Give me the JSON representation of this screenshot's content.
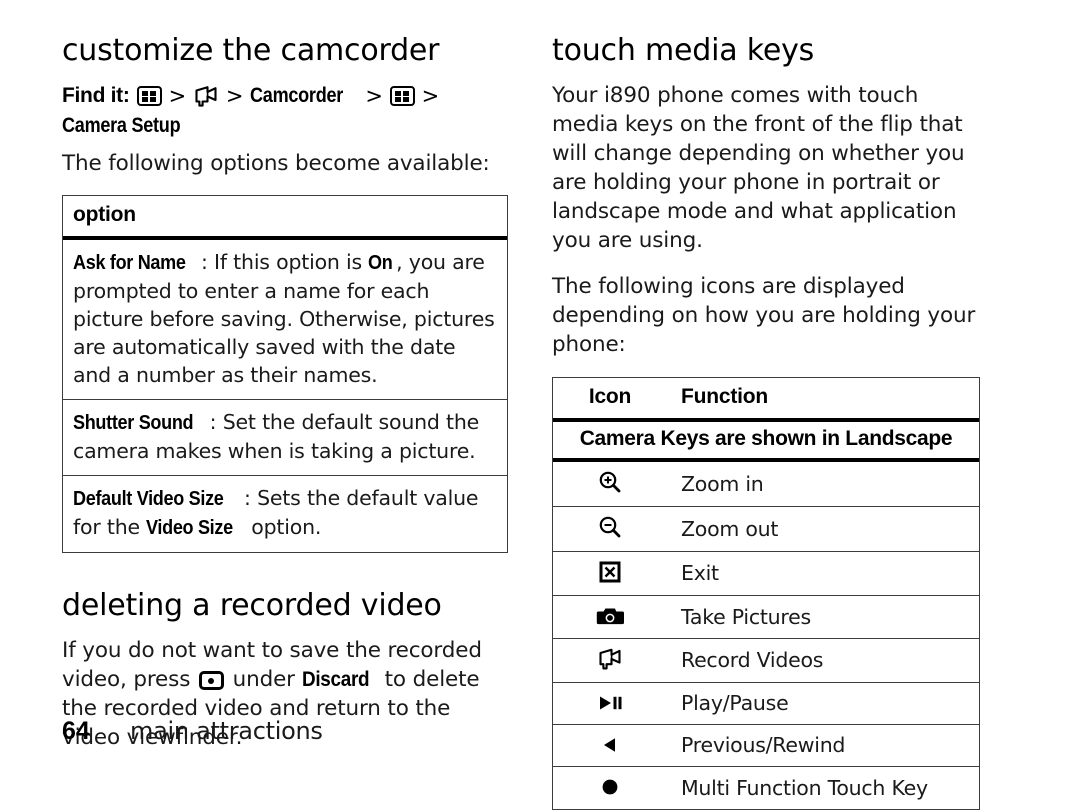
{
  "left_column": {
    "section1_title": "customize the camcorder",
    "find_it": {
      "label": "Find it:",
      "icon1": "menu-grid-icon",
      "sep": ">",
      "icon2": "camcorder-icon",
      "step1": "Camcorder",
      "icon3": "menu-grid-icon",
      "step2": "Camera Setup"
    },
    "intro": "The following options become available:",
    "options_table": {
      "header": "option",
      "rows": [
        {
          "term": "Ask for Name",
          "colon": ":",
          "text_a": " If this option is ",
          "term2": "On",
          "text_b": ", you are prompted to enter a name for each picture before saving. Otherwise, pictures are automatically saved with the date and a number as their names."
        },
        {
          "term": "Shutter Sound",
          "colon": ":",
          "text_a": " Set the default sound the camera makes when is taking a picture."
        },
        {
          "term": "Default Video Size",
          "colon": ":",
          "text_a": " Sets the default value for the ",
          "term2": "Video Size",
          "text_b": " option."
        }
      ]
    },
    "section2_title": "deleting a recorded video",
    "delete_text_a": "If you do not want to save the recorded video, press ",
    "delete_icon": "center-select-key-icon",
    "delete_text_b": " under ",
    "delete_bold": "Discard",
    "delete_text_c": " to delete the recorded video and return to the video viewfinder."
  },
  "right_column": {
    "section_title": "touch media keys",
    "paragraph1": "Your i890 phone comes with touch media keys on the front of the flip that will change depending on whether you are holding your phone in portrait or landscape mode and what application you are using.",
    "paragraph2": "The following icons are displayed depending on how you are holding your phone:",
    "icon_table": {
      "col_icon": "Icon",
      "col_function": "Function",
      "banner": "Camera Keys are shown in Landscape",
      "rows": [
        {
          "icon": "zoom-in-icon",
          "function": "Zoom in"
        },
        {
          "icon": "zoom-out-icon",
          "function": "Zoom out"
        },
        {
          "icon": "exit-box-x-icon",
          "function": "Exit"
        },
        {
          "icon": "camera-icon",
          "function": "Take Pictures"
        },
        {
          "icon": "camcorder-icon",
          "function": "Record Videos"
        },
        {
          "icon": "play-pause-icon",
          "function": "Play/Pause"
        },
        {
          "icon": "previous-rewind-icon",
          "function": "Previous/Rewind"
        },
        {
          "icon": "multi-function-dot-icon",
          "function": "Multi Function Touch Key"
        }
      ]
    }
  },
  "footer": {
    "page_number": "64",
    "chapter": "main attractions"
  },
  "colors": {
    "text": "#000000",
    "body_text": "#1a1a1a",
    "rule": "#3c3c3c",
    "background": "#ffffff"
  }
}
